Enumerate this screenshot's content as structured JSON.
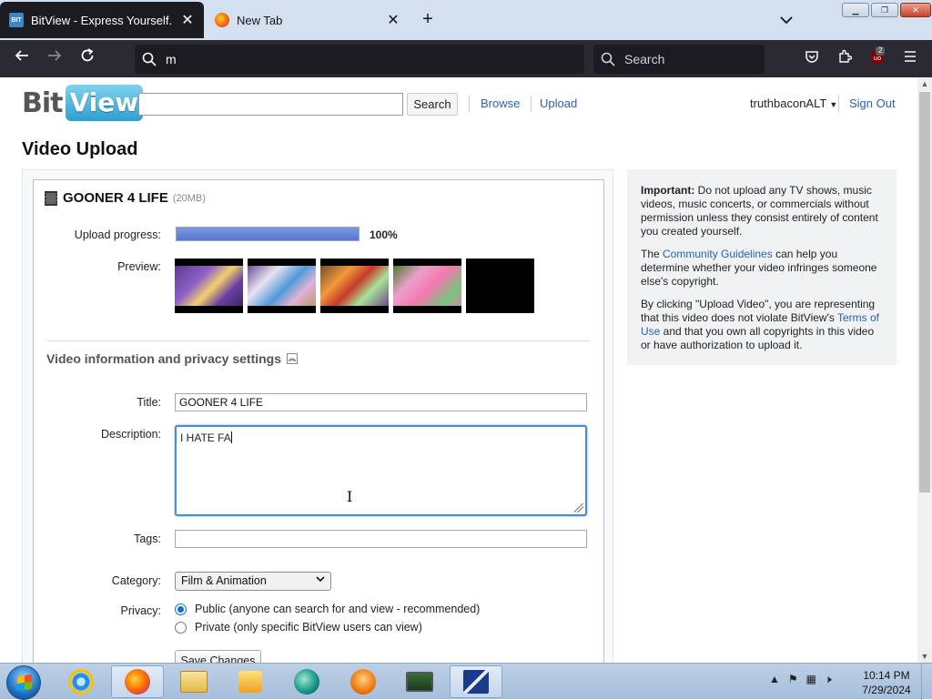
{
  "browser": {
    "tabs": [
      {
        "title": "BitView - Express Yourself.",
        "favicon": "bitview-icon"
      },
      {
        "title": "New Tab",
        "favicon": "firefox-icon"
      }
    ],
    "new_tab_symbol": "+",
    "url_text": "m",
    "search_placeholder": "Search",
    "extension_badge": "2"
  },
  "site": {
    "logo_left": "Bit",
    "logo_right": "View",
    "search_button": "Search",
    "nav": {
      "browse": "Browse",
      "upload": "Upload"
    },
    "username": "truthbaconALT",
    "sign_out": "Sign Out"
  },
  "upload": {
    "page_title": "Video Upload",
    "file_name": "GOONER 4 LIFE",
    "file_size": "(20MB)",
    "progress_label": "Upload progress:",
    "progress_percent": "100%",
    "progress_value": 1.0,
    "preview_label": "Preview:",
    "section_title": "Video information and privacy settings",
    "title_label": "Title:",
    "title_value": "GOONER 4 LIFE",
    "description_label": "Description:",
    "description_value": "I HATE FA",
    "tags_label": "Tags:",
    "tags_value": "",
    "category_label": "Category:",
    "category_value": "Film & Animation",
    "privacy_label": "Privacy:",
    "privacy_options": [
      {
        "label": "Public (anyone can search for and view - recommended)",
        "selected": true
      },
      {
        "label": "Private (only specific BitView users can view)",
        "selected": false
      }
    ],
    "save_button": "Save Changes"
  },
  "notice": {
    "important_label": "Important:",
    "p1_text": " Do not upload any TV shows, music videos, music concerts, or commercials without permission unless they consist entirely of content you created yourself.",
    "p2_pre": "The ",
    "p2_link": "Community Guidelines",
    "p2_post": " can help you determine whether your video infringes someone else's copyright.",
    "p3_pre": "By clicking \"Upload Video\", you are representing that this video does not violate BitView's ",
    "p3_link": "Terms of Use",
    "p3_post": " and that you own all copyrights in this video or have authorization to upload it."
  },
  "taskbar": {
    "time": "10:14 PM",
    "date": "7/29/2024"
  },
  "colors": {
    "link": "#2a60b5",
    "progress": "#5576d3",
    "focus": "#4a8ad6",
    "browser_dark": "#2b2a33"
  }
}
